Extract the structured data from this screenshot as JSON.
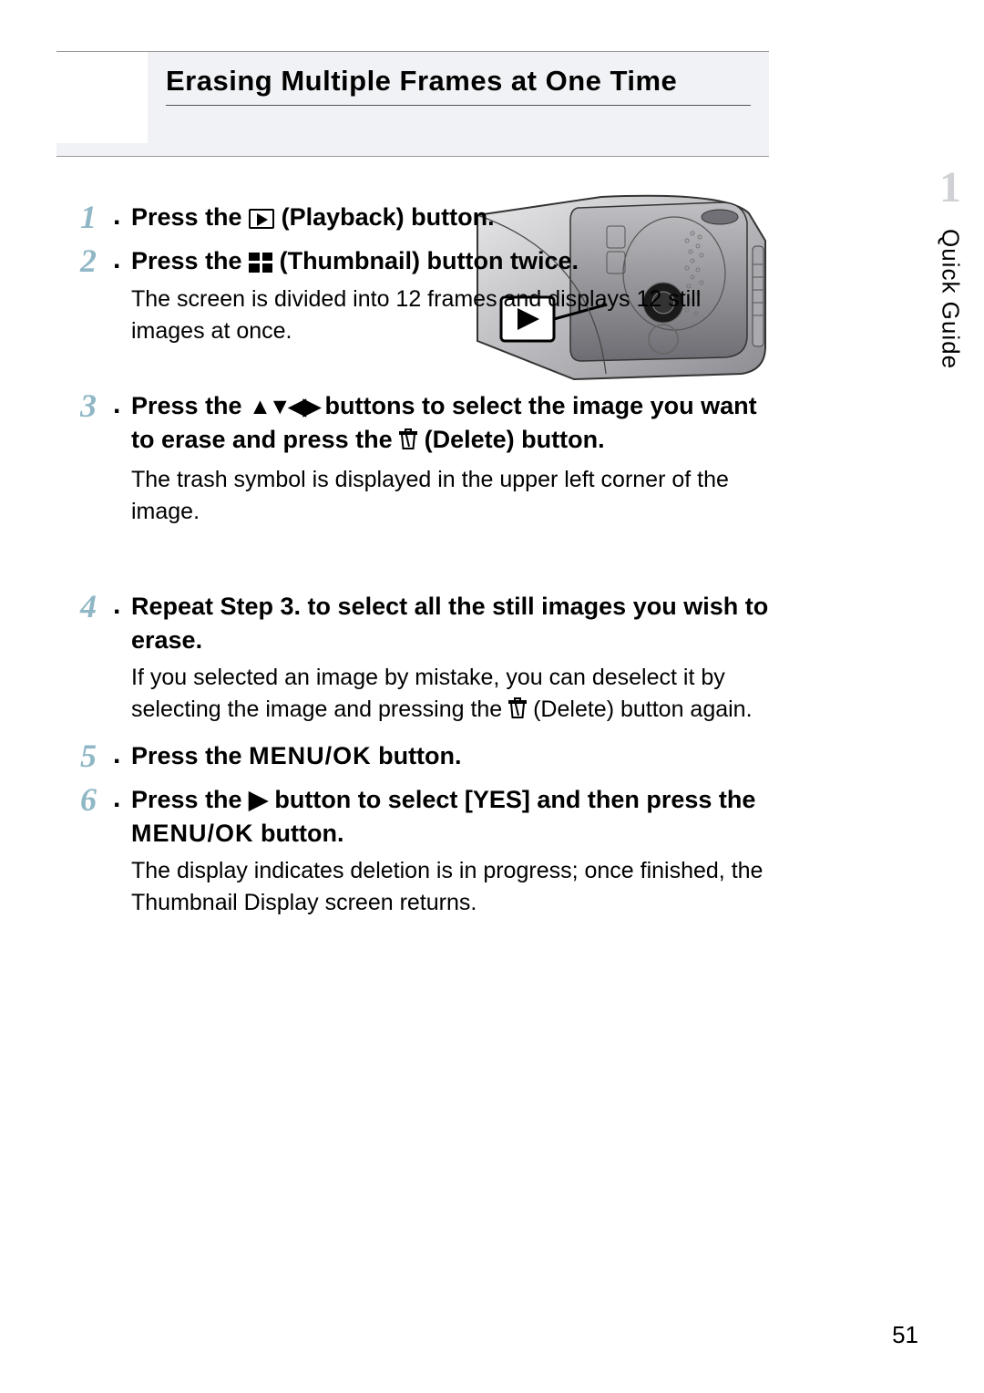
{
  "header": {
    "title": "Erasing Multiple Frames at One Time"
  },
  "sidebar": {
    "chapter_number": "1",
    "chapter_label": "Quick Guide"
  },
  "steps": [
    {
      "num": "1",
      "title_pre": "Press the ",
      "title_post": " (Playback) button."
    },
    {
      "num": "2",
      "title_pre": "Press the ",
      "title_post": " (Thumbnail) button twice.",
      "body": "The screen is divided into 12 frames and displays 12 still images at once."
    },
    {
      "num": "3",
      "title_pre": "Press the ",
      "title_mid": " buttons to select the image you want to erase and press the ",
      "title_post": " (Delete) button.",
      "body": "The trash symbol is displayed in the upper left corner of the image."
    },
    {
      "num": "4",
      "title": "Repeat Step 3. to select all the still images you wish to erase.",
      "body_pre": "If you selected an image by mistake, you can deselect it by selecting the image and pressing the ",
      "body_post": " (Delete) button again."
    },
    {
      "num": "5",
      "title_pre": "Press the ",
      "menuok": "MENU/OK",
      "title_post": " button."
    },
    {
      "num": "6",
      "title_pre": "Press the ",
      "title_mid": " button to select [YES] and then press the ",
      "menuok": "MENU/OK",
      "title_post": " button.",
      "body": "The display indicates deletion is in progress; once finished, the Thumbnail Display screen returns."
    }
  ],
  "page_number": "51"
}
